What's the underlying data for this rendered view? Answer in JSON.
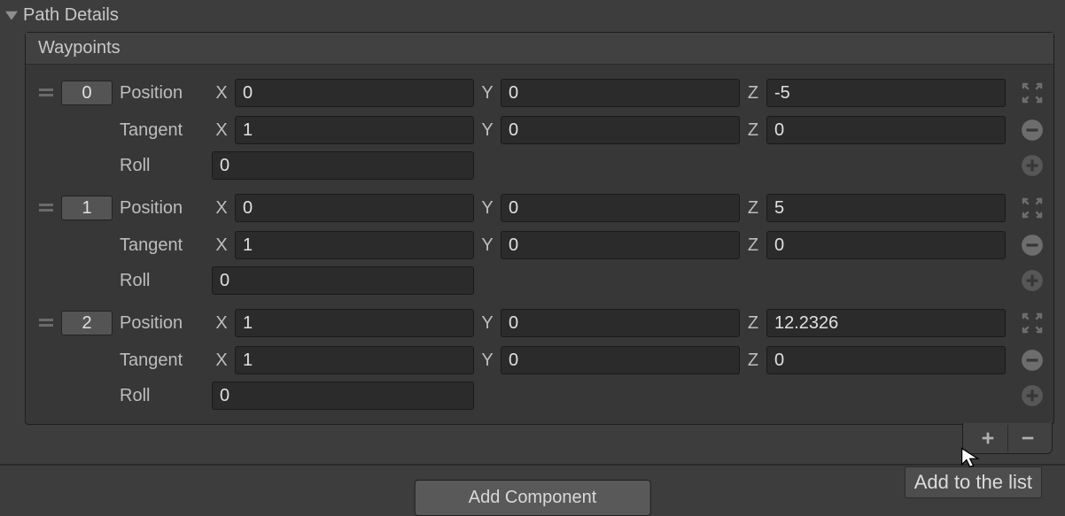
{
  "header": {
    "title": "Path Details"
  },
  "panel": {
    "title": "Waypoints",
    "labels": {
      "position": "Position",
      "tangent": "Tangent",
      "roll": "Roll",
      "x": "X",
      "y": "Y",
      "z": "Z"
    },
    "waypoints": [
      {
        "index": "0",
        "position": {
          "x": "0",
          "y": "0",
          "z": "-5"
        },
        "tangent": {
          "x": "1",
          "y": "0",
          "z": "0"
        },
        "roll": "0"
      },
      {
        "index": "1",
        "position": {
          "x": "0",
          "y": "0",
          "z": "5"
        },
        "tangent": {
          "x": "1",
          "y": "0",
          "z": "0"
        },
        "roll": "0"
      },
      {
        "index": "2",
        "position": {
          "x": "1",
          "y": "0",
          "z": "12.2326"
        },
        "tangent": {
          "x": "1",
          "y": "0",
          "z": "0"
        },
        "roll": "0"
      }
    ]
  },
  "footer": {
    "add_component_label": "Add Component",
    "tooltip": "Add to the list"
  }
}
